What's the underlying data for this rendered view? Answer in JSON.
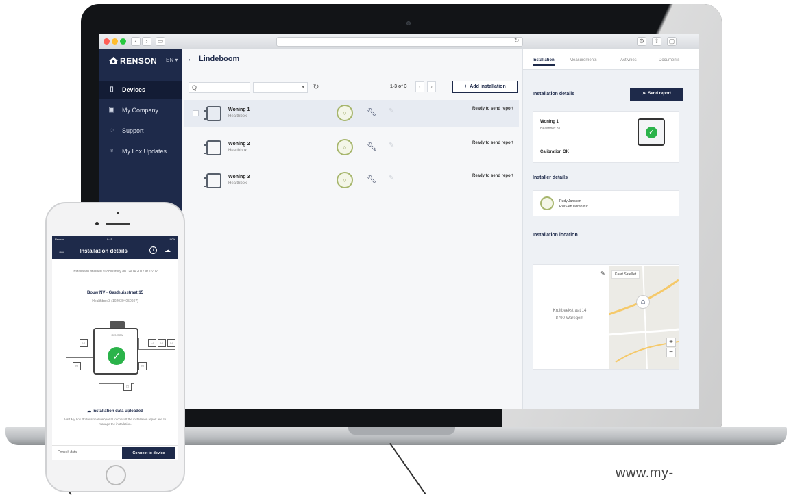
{
  "browser": {
    "dot_colors": [
      "#ff5f56",
      "#ffbd2e",
      "#27c93f"
    ]
  },
  "brand": {
    "logo_text": "RENSON",
    "lang": "EN"
  },
  "sidebar": {
    "items": [
      {
        "label": "Devices",
        "icon": "tablet-icon"
      },
      {
        "label": "My Company",
        "icon": "building-icon"
      },
      {
        "label": "Support",
        "icon": "help-icon"
      },
      {
        "label": "My Lox Updates",
        "icon": "lightbulb-icon"
      }
    ]
  },
  "main": {
    "title": "Lindeboom",
    "search_placeholder": "",
    "filter_value": "",
    "pager_text": "1-3 of 3",
    "add_button": "Add installation",
    "rows": [
      {
        "name": "Woning 1",
        "sub": "Healthbox",
        "circle": "○",
        "status": "Ready to send report",
        "stamp": ""
      },
      {
        "name": "Woning 2",
        "sub": "Healthbox",
        "circle": "○",
        "status": "Ready to send report",
        "stamp": ""
      },
      {
        "name": "Woning 3",
        "sub": "Healthbox",
        "circle": "○",
        "status": "Ready to send report",
        "stamp": ""
      }
    ]
  },
  "panel": {
    "tabs": [
      "Installation",
      "Measurements",
      "Activities",
      "Documents"
    ],
    "installation_details": "Installation details",
    "send_report": "Send report",
    "device_name": "Woning 1",
    "device_model": "Healthbox 3.0",
    "calibration": "Calibration OK",
    "installer_details": "Installer details",
    "installer_line1": "Rudy Janssen",
    "installer_line2": "RWS en Doran NV",
    "installation_location": "Installation location",
    "address_line1": "Kruitbeekstraat 14",
    "address_line2": "8790 Waregem",
    "map_tabs": "Kaart  Satelliet",
    "map_place1": "",
    "map_place2": ""
  },
  "phone": {
    "status_left": "Renson",
    "status_center": "9:41",
    "status_right": "100%",
    "header_title": "Installation details",
    "message": "Installation finished successfully on 14/04/2017 at 16:02",
    "location": "Bouw NV - Gasthuisstraat 15",
    "device": "Healthbox 3 (1020304050607)",
    "unit_brand": "RENSON",
    "uploaded": "Installation data uploaded",
    "note": "Visit My Lox Professional webportal to consult the installation report and to manage the installation.",
    "consult": "Consult data",
    "connect": "Connect to device"
  },
  "watermark": "www.my-"
}
